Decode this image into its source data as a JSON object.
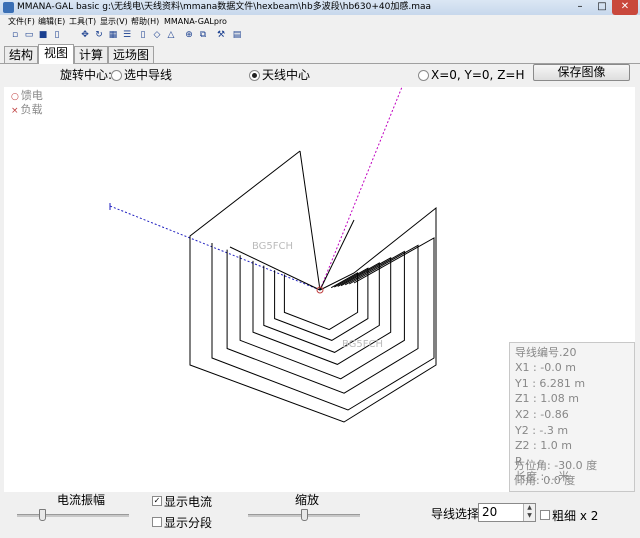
{
  "window": {
    "title": "MMANA-GAL basic g:\\无线电\\天线资料\\mmana数据文件\\hexbeam\\hb多波段\\hb630+40加感.maa"
  },
  "menu": [
    "文件(F)",
    "编辑(E)",
    "工具(T)",
    "显示(V)",
    "帮助(H)",
    "MMANA-GALpro"
  ],
  "toolbar_icons": [
    "new-icon",
    "open-icon",
    "save-icon",
    "doc-icon",
    "move-icon",
    "rotate-icon",
    "table-icon",
    "list-icon",
    "page-icon",
    "shape-icon",
    "triangle-icon",
    "zoom-icon",
    "copy-icon",
    "tools-icon",
    "calculator-icon"
  ],
  "tabs": [
    "结构",
    "视图",
    "计算",
    "远场图"
  ],
  "active_tab": "视图",
  "rotation": {
    "label": "旋转中心:",
    "options": [
      "选中导线",
      "天线中心",
      "X=0, Y=0, Z=H"
    ],
    "selected": "天线中心"
  },
  "save_button": "保存图像",
  "legend": {
    "feed": "馈电",
    "load": "负载"
  },
  "watermarks": [
    "BG5FCH",
    "BG5FCH"
  ],
  "wire_info": {
    "number": "导线编号.20",
    "x1": "X1  :  -0.0 m",
    "y1": "Y1  :  6.281 m",
    "z1": "Z1  :  1.08 m",
    "x2": "X2  :  -0.86",
    "y2": "Y2  :  -.3 m",
    "z2": "Z2  :  1.0 m",
    "r": "R  :  ...",
    "length": "长度  :  ...米",
    "azimuth": "方位角:  -30.0 度",
    "elevation": "仰角:  0.0 度"
  },
  "controls": {
    "current_amp_label": "电流振幅",
    "current_amp_level": 0.22,
    "show_current_label": "显示电流",
    "show_current_checked": true,
    "show_segments_label": "显示分段",
    "show_segments_checked": false,
    "zoom_label": "缩放",
    "zoom_level": 0.5,
    "wire_select_label": "导线选择",
    "wire_select_value": "20",
    "thick_label": "粗细 x 2",
    "thick_checked": false
  },
  "colors": {
    "feed_mark": "#c04040",
    "y_axis": "#c000c0",
    "x_axis": "#2020c0",
    "wire": "#000000"
  }
}
